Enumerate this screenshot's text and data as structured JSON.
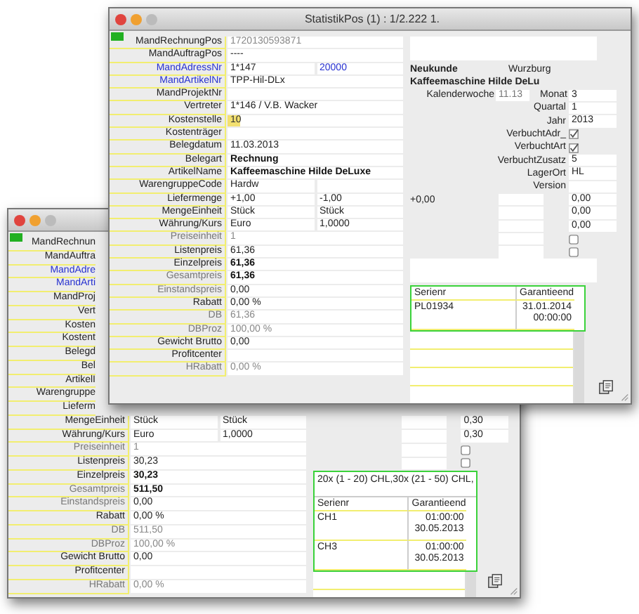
{
  "windows": [
    {
      "title": "StatistikPos (1) : 1/2.222 1.",
      "rows": [
        {
          "label": "MandRechnungPos",
          "kind": "normal",
          "values": [
            {
              "text": "1720130593871",
              "kind": "dim"
            }
          ]
        },
        {
          "label": "MandAuftragPos",
          "kind": "normal",
          "values": [
            {
              "text": "----",
              "kind": "plain"
            }
          ]
        },
        {
          "label": "MandAdressNr",
          "kind": "link",
          "values": [
            {
              "text": "1*147",
              "kind": "plain"
            },
            {
              "text": "20000",
              "kind": "link"
            }
          ]
        },
        {
          "label": "MandArtikelNr",
          "kind": "link",
          "values": [
            {
              "text": "TPP-Hil-DLx",
              "kind": "plain"
            }
          ]
        },
        {
          "label": "MandProjektNr",
          "kind": "normal",
          "values": [
            {
              "kind": "plain"
            }
          ]
        },
        {
          "label": "Vertreter",
          "kind": "normal",
          "values": [
            {
              "text": "1*146 / V.B. Wacker",
              "kind": "plain"
            }
          ]
        },
        {
          "label": "Kostenstelle",
          "kind": "normal",
          "values": [
            {
              "text": "10",
              "kind": "marked"
            }
          ]
        },
        {
          "label": "Kostenträger",
          "kind": "normal",
          "values": [
            {
              "kind": "plain"
            }
          ]
        },
        {
          "label": "Belegdatum",
          "kind": "normal",
          "values": [
            {
              "text": "11.03.2013",
              "kind": "plain"
            }
          ]
        },
        {
          "label": "Belegart",
          "kind": "normal",
          "values": [
            {
              "text": "Rechnung",
              "kind": "bold"
            }
          ]
        },
        {
          "label": "ArtikelName",
          "kind": "normal",
          "values": [
            {
              "text": "Kaffeemaschine Hilde DeLuxe",
              "kind": "bold"
            }
          ]
        },
        {
          "label": "WarengruppeCode",
          "kind": "normal",
          "values": [
            {
              "text": "Hardw",
              "kind": "plain"
            },
            {
              "kind": "plain"
            }
          ]
        },
        {
          "label": "Liefermenge",
          "kind": "normal",
          "values": [
            {
              "text": "+1,00",
              "kind": "plain"
            },
            {
              "text": "-1,00",
              "kind": "plain"
            }
          ]
        },
        {
          "label": "MengeEinheit",
          "kind": "normal",
          "values": [
            {
              "text": "Stück",
              "kind": "plain"
            },
            {
              "text": "Stück",
              "kind": "plain"
            }
          ]
        },
        {
          "label": "Währung/Kurs",
          "kind": "normal",
          "values": [
            {
              "text": "Euro",
              "kind": "plain"
            },
            {
              "text": "1,0000",
              "kind": "plain"
            }
          ]
        },
        {
          "label": "Preiseinheit",
          "kind": "dim",
          "values": [
            {
              "text": "1",
              "kind": "dim"
            }
          ]
        },
        {
          "label": "Listenpreis",
          "kind": "normal",
          "values": [
            {
              "text": "61,36",
              "kind": "plain"
            }
          ]
        },
        {
          "label": "Einzelpreis",
          "kind": "normal",
          "values": [
            {
              "text": "61,36",
              "kind": "bold"
            }
          ]
        },
        {
          "label": "Gesamtpreis",
          "kind": "dim",
          "values": [
            {
              "text": "61,36",
              "kind": "bold"
            }
          ]
        },
        {
          "label": "Einstandspreis",
          "kind": "dim",
          "values": [
            {
              "text": "0,00",
              "kind": "plain"
            }
          ]
        },
        {
          "label": "Rabatt",
          "kind": "normal",
          "values": [
            {
              "text": "0,00 %",
              "kind": "plain"
            }
          ]
        },
        {
          "label": "DB",
          "kind": "dim",
          "values": [
            {
              "text": "61,36",
              "kind": "dim"
            }
          ]
        },
        {
          "label": "DBProz",
          "kind": "dim",
          "values": [
            {
              "text": "100,00 %",
              "kind": "dim"
            }
          ]
        },
        {
          "label": "Gewicht Brutto",
          "kind": "normal",
          "values": [
            {
              "text": "0,00",
              "kind": "plain"
            }
          ]
        },
        {
          "label": "Profitcenter",
          "kind": "normal",
          "values": [
            {
              "kind": "plain"
            }
          ]
        },
        {
          "label": "HRabatt",
          "kind": "dim",
          "values": [
            {
              "text": "0,00 %",
              "kind": "dim"
            }
          ]
        }
      ],
      "side": [
        {
          "kind": "note"
        },
        {
          "kind": "info",
          "texts": [
            "Neukunde",
            "Wurzburg"
          ]
        },
        {
          "kind": "heading",
          "text": "Kaffeemaschine Hilde DeLu"
        },
        {
          "kind": "double",
          "label": "Kalenderwoche",
          "value": "11.13",
          "label2": "Monat",
          "value2": "3"
        },
        {
          "kind": "field",
          "label": "Quartal",
          "value": "1"
        },
        {
          "kind": "field",
          "label": "Jahr",
          "value": "2013"
        },
        {
          "kind": "check",
          "label": "VerbuchtAdr_",
          "checked": true
        },
        {
          "kind": "check",
          "label": "VerbuchtArt",
          "checked": true
        },
        {
          "kind": "field",
          "label": "VerbuchtZusatz",
          "value": "5"
        },
        {
          "kind": "field",
          "label": "LagerOrt",
          "value": "HL"
        },
        {
          "kind": "field",
          "label": "Version"
        },
        {
          "kind": "amount",
          "text": "+0,00",
          "value": "0,00"
        },
        {
          "kind": "amount",
          "value": "0,00"
        },
        {
          "kind": "amount",
          "value": "0,00"
        },
        {
          "kind": "tick",
          "checked": false
        },
        {
          "kind": "tick",
          "checked": false
        },
        {
          "kind": "note"
        },
        {
          "kind": "table",
          "columns": [
            "Serienr",
            "Garantieend"
          ],
          "rows": [
            {
              "cells": [
                "PL01934",
                "31.01.2014\n00:00:00"
              ]
            }
          ]
        }
      ]
    },
    {
      "hidden_rows": [
        {
          "label": "MandRechnun",
          "kind": "normal"
        },
        {
          "label": "MandAuftra",
          "kind": "normal"
        },
        {
          "label": "MandAdre",
          "kind": "link"
        },
        {
          "label": "MandArti",
          "kind": "link"
        },
        {
          "label": "MandProj",
          "kind": "normal"
        },
        {
          "label": "Vert",
          "kind": "normal"
        },
        {
          "label": "Kosten",
          "kind": "normal"
        },
        {
          "label": "Kostent",
          "kind": "normal"
        },
        {
          "label": "Belegd",
          "kind": "normal"
        },
        {
          "label": "Bel",
          "kind": "normal"
        },
        {
          "label": "ArtikelI",
          "kind": "normal"
        },
        {
          "label": "Warengruppe",
          "kind": "normal"
        },
        {
          "label": "Lieferm",
          "kind": "normal"
        }
      ],
      "rows": [
        {
          "label": "MengeEinheit",
          "kind": "normal",
          "values": [
            {
              "text": "Stück",
              "kind": "plain"
            },
            {
              "text": "Stück",
              "kind": "plain"
            }
          ]
        },
        {
          "label": "Währung/Kurs",
          "kind": "normal",
          "values": [
            {
              "text": "Euro",
              "kind": "plain"
            },
            {
              "text": "1,0000",
              "kind": "plain"
            }
          ]
        },
        {
          "label": "Preiseinheit",
          "kind": "dim",
          "values": [
            {
              "text": "1",
              "kind": "dim"
            }
          ]
        },
        {
          "label": "Listenpreis",
          "kind": "normal",
          "values": [
            {
              "text": "30,23",
              "kind": "plain"
            }
          ]
        },
        {
          "label": "Einzelpreis",
          "kind": "normal",
          "values": [
            {
              "text": "30,23",
              "kind": "bold"
            }
          ]
        },
        {
          "label": "Gesamtpreis",
          "kind": "dim",
          "values": [
            {
              "text": "511,50",
              "kind": "bold"
            }
          ]
        },
        {
          "label": "Einstandspreis",
          "kind": "dim",
          "values": [
            {
              "text": "0,00",
              "kind": "plain"
            }
          ]
        },
        {
          "label": "Rabatt",
          "kind": "normal",
          "values": [
            {
              "text": "0,00 %",
              "kind": "plain"
            }
          ]
        },
        {
          "label": "DB",
          "kind": "dim",
          "values": [
            {
              "text": "511,50",
              "kind": "dim"
            }
          ]
        },
        {
          "label": "DBProz",
          "kind": "dim",
          "values": [
            {
              "text": "100,00 %",
              "kind": "dim"
            }
          ]
        },
        {
          "label": "Gewicht Brutto",
          "kind": "normal",
          "values": [
            {
              "text": "0,00",
              "kind": "plain"
            }
          ]
        },
        {
          "label": "Profitcenter",
          "kind": "normal",
          "values": [
            {
              "kind": "plain"
            }
          ]
        },
        {
          "label": "HRabatt",
          "kind": "dim",
          "values": [
            {
              "text": "0,00 %",
              "kind": "dim"
            }
          ]
        }
      ],
      "side": [
        {
          "kind": "amount",
          "value": "0,30"
        },
        {
          "kind": "amount",
          "value": "0,30"
        },
        {
          "kind": "tick",
          "checked": false
        },
        {
          "kind": "tick",
          "checked": false
        },
        {
          "kind": "table",
          "note": "20x (1 - 20) CHL,30x (21 - 50) CHL,",
          "columns": [
            "Serienr",
            "Garantieend"
          ],
          "rows": [
            {
              "cells": [
                "CH1",
                "01:00:00\n30.05.2013"
              ]
            },
            {
              "cells": [
                "CH3",
                "01:00:00\n30.05.2013"
              ]
            }
          ]
        }
      ]
    }
  ]
}
